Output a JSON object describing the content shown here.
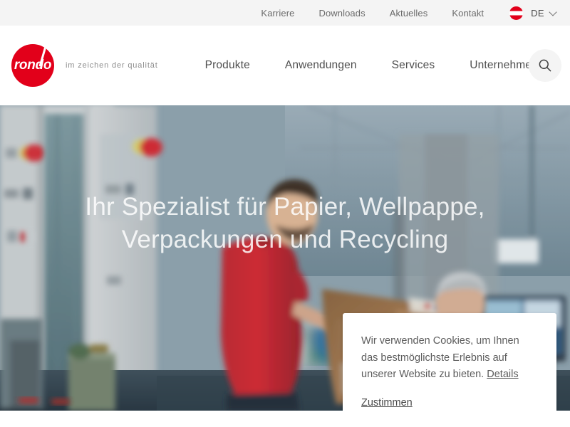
{
  "brand": {
    "logo_word": "rondo",
    "tagline": "im zeichen der qualität",
    "accent_color": "#e2001a"
  },
  "topbar": {
    "background": "#f4f4f4",
    "links": [
      {
        "label": "Karriere"
      },
      {
        "label": "Downloads"
      },
      {
        "label": "Aktuelles"
      },
      {
        "label": "Kontakt"
      }
    ],
    "language": {
      "flag_icon": "austria-flag-icon",
      "code": "DE",
      "chevron_icon": "chevron-down-icon"
    }
  },
  "header": {
    "nav": [
      {
        "label": "Produkte"
      },
      {
        "label": "Anwendungen"
      },
      {
        "label": "Services"
      },
      {
        "label": "Unternehmen"
      }
    ],
    "search": {
      "icon": "search-icon",
      "aria_label": "Suche"
    }
  },
  "hero": {
    "headline": "Ihr Spezialist für Papier, Wellpappe, Verpackungen und Recycling",
    "image_description": "Zwei Mitarbeiter in roten Poloshirts prüfen einen Wellpappe-Zuschnitt in einer Produktionshalle"
  },
  "cookie_banner": {
    "message": "Wir verwenden Cookies, um Ihnen das bestmöglichste Erlebnis auf unserer Website zu bieten.",
    "details_label": "Details",
    "accept_label": "Zustimmen"
  }
}
